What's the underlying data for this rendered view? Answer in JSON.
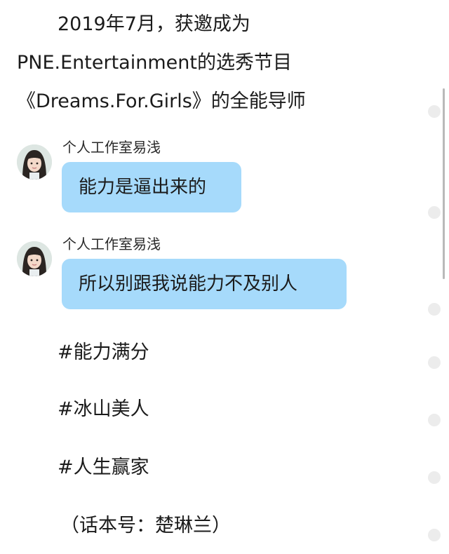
{
  "intro": {
    "line1": "2019年7月，获邀成为",
    "line2": "PNE.Entertainment的选秀节目",
    "line3": "《Dreams.For.Girls》的全能导师"
  },
  "messages": [
    {
      "sender": "个人工作室易浅",
      "text": "能力是逼出来的",
      "avatar_icon": "girl-avatar-icon"
    },
    {
      "sender": "个人工作室易浅",
      "text": "所以别跟我说能力不及别人",
      "avatar_icon": "girl-avatar-icon"
    }
  ],
  "hashtags": [
    "#能力满分",
    "#冰山美人",
    "#人生赢家"
  ],
  "footer_note": "（话本号：楚琳兰）",
  "colors": {
    "bubble": "#a6dafb",
    "text": "#1b1b1b",
    "page_background": "#ffffff",
    "scrollbar": "#b9b9b9",
    "side_dot": "#ececec"
  }
}
